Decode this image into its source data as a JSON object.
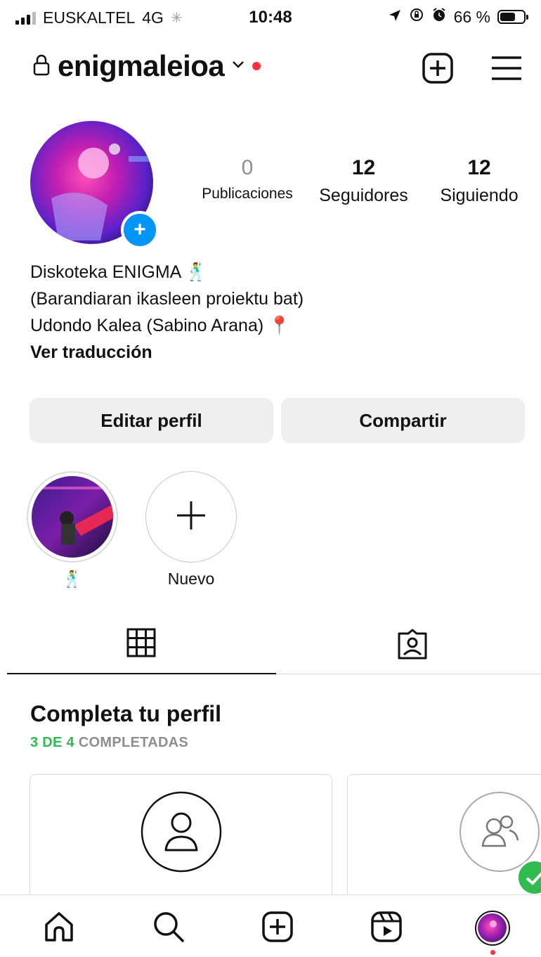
{
  "status_bar": {
    "carrier": "EUSKALTEL",
    "network": "4G",
    "time": "10:48",
    "battery": "66 %",
    "battery_level": 0.66
  },
  "header": {
    "username": "enigmaleioa",
    "icons": [
      "lock-icon",
      "chevron-down-icon",
      "notification-dot",
      "create-icon",
      "menu-icon"
    ]
  },
  "profile": {
    "stats": [
      {
        "value": "0",
        "label": "Publicaciones"
      },
      {
        "value": "12",
        "label": "Seguidores"
      },
      {
        "value": "12",
        "label": "Siguiendo"
      }
    ],
    "bio": {
      "line1": "Diskoteka ENIGMA 🕺",
      "line2": "(Barandiaran ikasleen proiektu bat)",
      "line3": "Udondo Kalea (Sabino Arana) 📍",
      "translate": "Ver traducción"
    },
    "buttons": {
      "edit": "Editar perfil",
      "share": "Compartir"
    }
  },
  "highlights": [
    {
      "label": "🕺"
    },
    {
      "label": "Nuevo"
    }
  ],
  "tabs": [
    "grid-icon",
    "tagged-icon"
  ],
  "complete_profile": {
    "title": "Completa tu perfil",
    "progress_count": "3 DE 4",
    "progress_label": " COMPLETADAS"
  },
  "bottom_nav": [
    "home-icon",
    "search-icon",
    "create-icon",
    "reels-icon",
    "profile-avatar"
  ],
  "colors": {
    "accent_blue": "#0095f6",
    "notification_red": "#ff3040",
    "complete_green": "#2fbb4f"
  }
}
